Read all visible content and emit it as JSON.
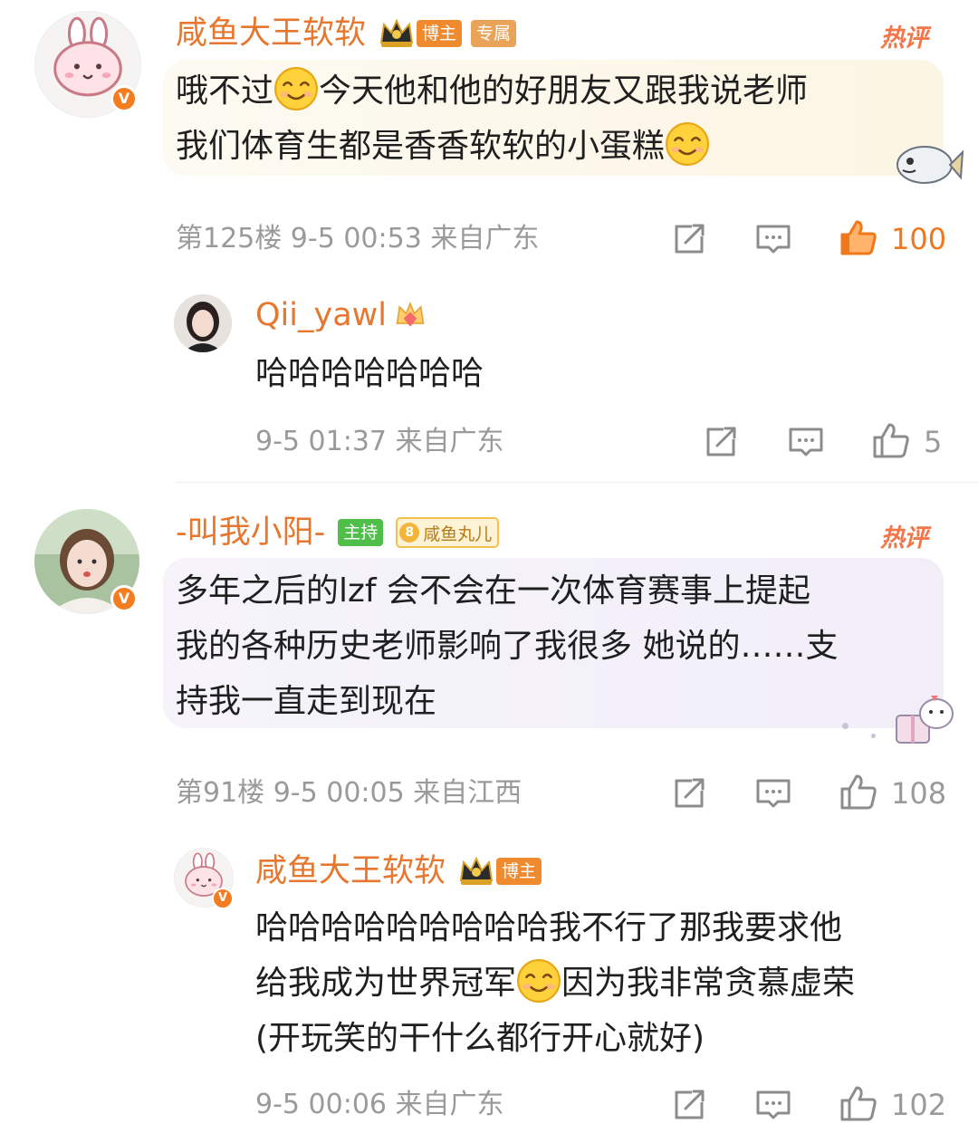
{
  "comments": [
    {
      "user": "咸鱼大王软软",
      "badges": [
        "博主",
        "专属"
      ],
      "tag": "热评",
      "text_parts": [
        "哦不过",
        "今天他和他的好朋友又跟我说老师",
        "我们体育生都是香香软软的小蛋糕"
      ],
      "meta": "第125楼 9-5 00:53 来自广东",
      "likes": "100",
      "liked": true,
      "replies": [
        {
          "user": "Qii_yawl",
          "text": "哈哈哈哈哈哈哈",
          "meta": "9-5 01:37 来自广东",
          "likes": "5"
        }
      ]
    },
    {
      "user": "-叫我小阳-",
      "badges": [
        "主持",
        "咸鱼丸儿"
      ],
      "fan_level": "8",
      "tag": "热评",
      "text_lines": [
        "多年之后的lzf  会不会在一次体育赛事上提起",
        "我的各种历史老师影响了我很多 她说的……支",
        "持我一直走到现在"
      ],
      "meta": "第91楼 9-5 00:05 来自江西",
      "likes": "108",
      "replies": [
        {
          "user": "咸鱼大王软软",
          "badges": [
            "博主"
          ],
          "text_parts": [
            "哈哈哈哈哈哈哈哈哈我不行了那我要求他",
            "给我成为世界冠军",
            "因为我非常贪慕虚荣",
            "(开玩笑的干什么都行开心就好)"
          ],
          "meta": "9-5 00:06 来自广东",
          "likes": "102"
        }
      ]
    }
  ],
  "icons": {
    "share": "share-icon",
    "comment": "comment-icon",
    "like": "thumbs-up-icon",
    "verified": "verified-v-icon",
    "emoji": "smile-emoji-icon"
  },
  "colors": {
    "name_orange": "#e7762e",
    "like_active": "#f0771c",
    "badge_blogger": "#f08a2e",
    "badge_exclusive": "#e9a45a",
    "badge_host": "#4fbf4a",
    "badge_fan": "#f2b53a",
    "meta_gray": "#9a9a9a"
  }
}
